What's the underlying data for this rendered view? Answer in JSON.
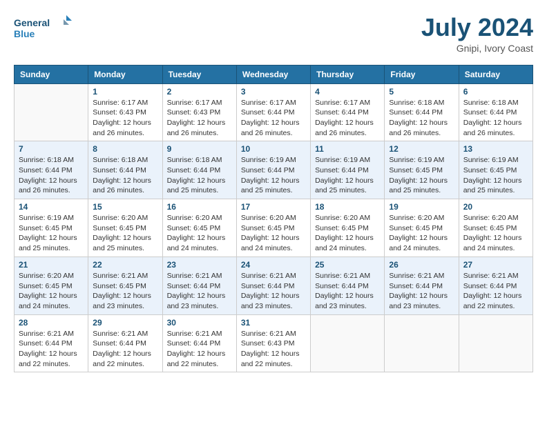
{
  "header": {
    "logo_line1": "General",
    "logo_line2": "Blue",
    "month_year": "July 2024",
    "location": "Gnipi, Ivory Coast"
  },
  "weekdays": [
    "Sunday",
    "Monday",
    "Tuesday",
    "Wednesday",
    "Thursday",
    "Friday",
    "Saturday"
  ],
  "weeks": [
    [
      {
        "day": "",
        "info": ""
      },
      {
        "day": "1",
        "info": "Sunrise: 6:17 AM\nSunset: 6:43 PM\nDaylight: 12 hours\nand 26 minutes."
      },
      {
        "day": "2",
        "info": "Sunrise: 6:17 AM\nSunset: 6:43 PM\nDaylight: 12 hours\nand 26 minutes."
      },
      {
        "day": "3",
        "info": "Sunrise: 6:17 AM\nSunset: 6:44 PM\nDaylight: 12 hours\nand 26 minutes."
      },
      {
        "day": "4",
        "info": "Sunrise: 6:17 AM\nSunset: 6:44 PM\nDaylight: 12 hours\nand 26 minutes."
      },
      {
        "day": "5",
        "info": "Sunrise: 6:18 AM\nSunset: 6:44 PM\nDaylight: 12 hours\nand 26 minutes."
      },
      {
        "day": "6",
        "info": "Sunrise: 6:18 AM\nSunset: 6:44 PM\nDaylight: 12 hours\nand 26 minutes."
      }
    ],
    [
      {
        "day": "7",
        "info": "Sunrise: 6:18 AM\nSunset: 6:44 PM\nDaylight: 12 hours\nand 26 minutes."
      },
      {
        "day": "8",
        "info": "Sunrise: 6:18 AM\nSunset: 6:44 PM\nDaylight: 12 hours\nand 26 minutes."
      },
      {
        "day": "9",
        "info": "Sunrise: 6:18 AM\nSunset: 6:44 PM\nDaylight: 12 hours\nand 25 minutes."
      },
      {
        "day": "10",
        "info": "Sunrise: 6:19 AM\nSunset: 6:44 PM\nDaylight: 12 hours\nand 25 minutes."
      },
      {
        "day": "11",
        "info": "Sunrise: 6:19 AM\nSunset: 6:44 PM\nDaylight: 12 hours\nand 25 minutes."
      },
      {
        "day": "12",
        "info": "Sunrise: 6:19 AM\nSunset: 6:45 PM\nDaylight: 12 hours\nand 25 minutes."
      },
      {
        "day": "13",
        "info": "Sunrise: 6:19 AM\nSunset: 6:45 PM\nDaylight: 12 hours\nand 25 minutes."
      }
    ],
    [
      {
        "day": "14",
        "info": "Sunrise: 6:19 AM\nSunset: 6:45 PM\nDaylight: 12 hours\nand 25 minutes."
      },
      {
        "day": "15",
        "info": "Sunrise: 6:20 AM\nSunset: 6:45 PM\nDaylight: 12 hours\nand 25 minutes."
      },
      {
        "day": "16",
        "info": "Sunrise: 6:20 AM\nSunset: 6:45 PM\nDaylight: 12 hours\nand 24 minutes."
      },
      {
        "day": "17",
        "info": "Sunrise: 6:20 AM\nSunset: 6:45 PM\nDaylight: 12 hours\nand 24 minutes."
      },
      {
        "day": "18",
        "info": "Sunrise: 6:20 AM\nSunset: 6:45 PM\nDaylight: 12 hours\nand 24 minutes."
      },
      {
        "day": "19",
        "info": "Sunrise: 6:20 AM\nSunset: 6:45 PM\nDaylight: 12 hours\nand 24 minutes."
      },
      {
        "day": "20",
        "info": "Sunrise: 6:20 AM\nSunset: 6:45 PM\nDaylight: 12 hours\nand 24 minutes."
      }
    ],
    [
      {
        "day": "21",
        "info": "Sunrise: 6:20 AM\nSunset: 6:45 PM\nDaylight: 12 hours\nand 24 minutes."
      },
      {
        "day": "22",
        "info": "Sunrise: 6:21 AM\nSunset: 6:45 PM\nDaylight: 12 hours\nand 23 minutes."
      },
      {
        "day": "23",
        "info": "Sunrise: 6:21 AM\nSunset: 6:44 PM\nDaylight: 12 hours\nand 23 minutes."
      },
      {
        "day": "24",
        "info": "Sunrise: 6:21 AM\nSunset: 6:44 PM\nDaylight: 12 hours\nand 23 minutes."
      },
      {
        "day": "25",
        "info": "Sunrise: 6:21 AM\nSunset: 6:44 PM\nDaylight: 12 hours\nand 23 minutes."
      },
      {
        "day": "26",
        "info": "Sunrise: 6:21 AM\nSunset: 6:44 PM\nDaylight: 12 hours\nand 23 minutes."
      },
      {
        "day": "27",
        "info": "Sunrise: 6:21 AM\nSunset: 6:44 PM\nDaylight: 12 hours\nand 22 minutes."
      }
    ],
    [
      {
        "day": "28",
        "info": "Sunrise: 6:21 AM\nSunset: 6:44 PM\nDaylight: 12 hours\nand 22 minutes."
      },
      {
        "day": "29",
        "info": "Sunrise: 6:21 AM\nSunset: 6:44 PM\nDaylight: 12 hours\nand 22 minutes."
      },
      {
        "day": "30",
        "info": "Sunrise: 6:21 AM\nSunset: 6:44 PM\nDaylight: 12 hours\nand 22 minutes."
      },
      {
        "day": "31",
        "info": "Sunrise: 6:21 AM\nSunset: 6:43 PM\nDaylight: 12 hours\nand 22 minutes."
      },
      {
        "day": "",
        "info": ""
      },
      {
        "day": "",
        "info": ""
      },
      {
        "day": "",
        "info": ""
      }
    ]
  ]
}
